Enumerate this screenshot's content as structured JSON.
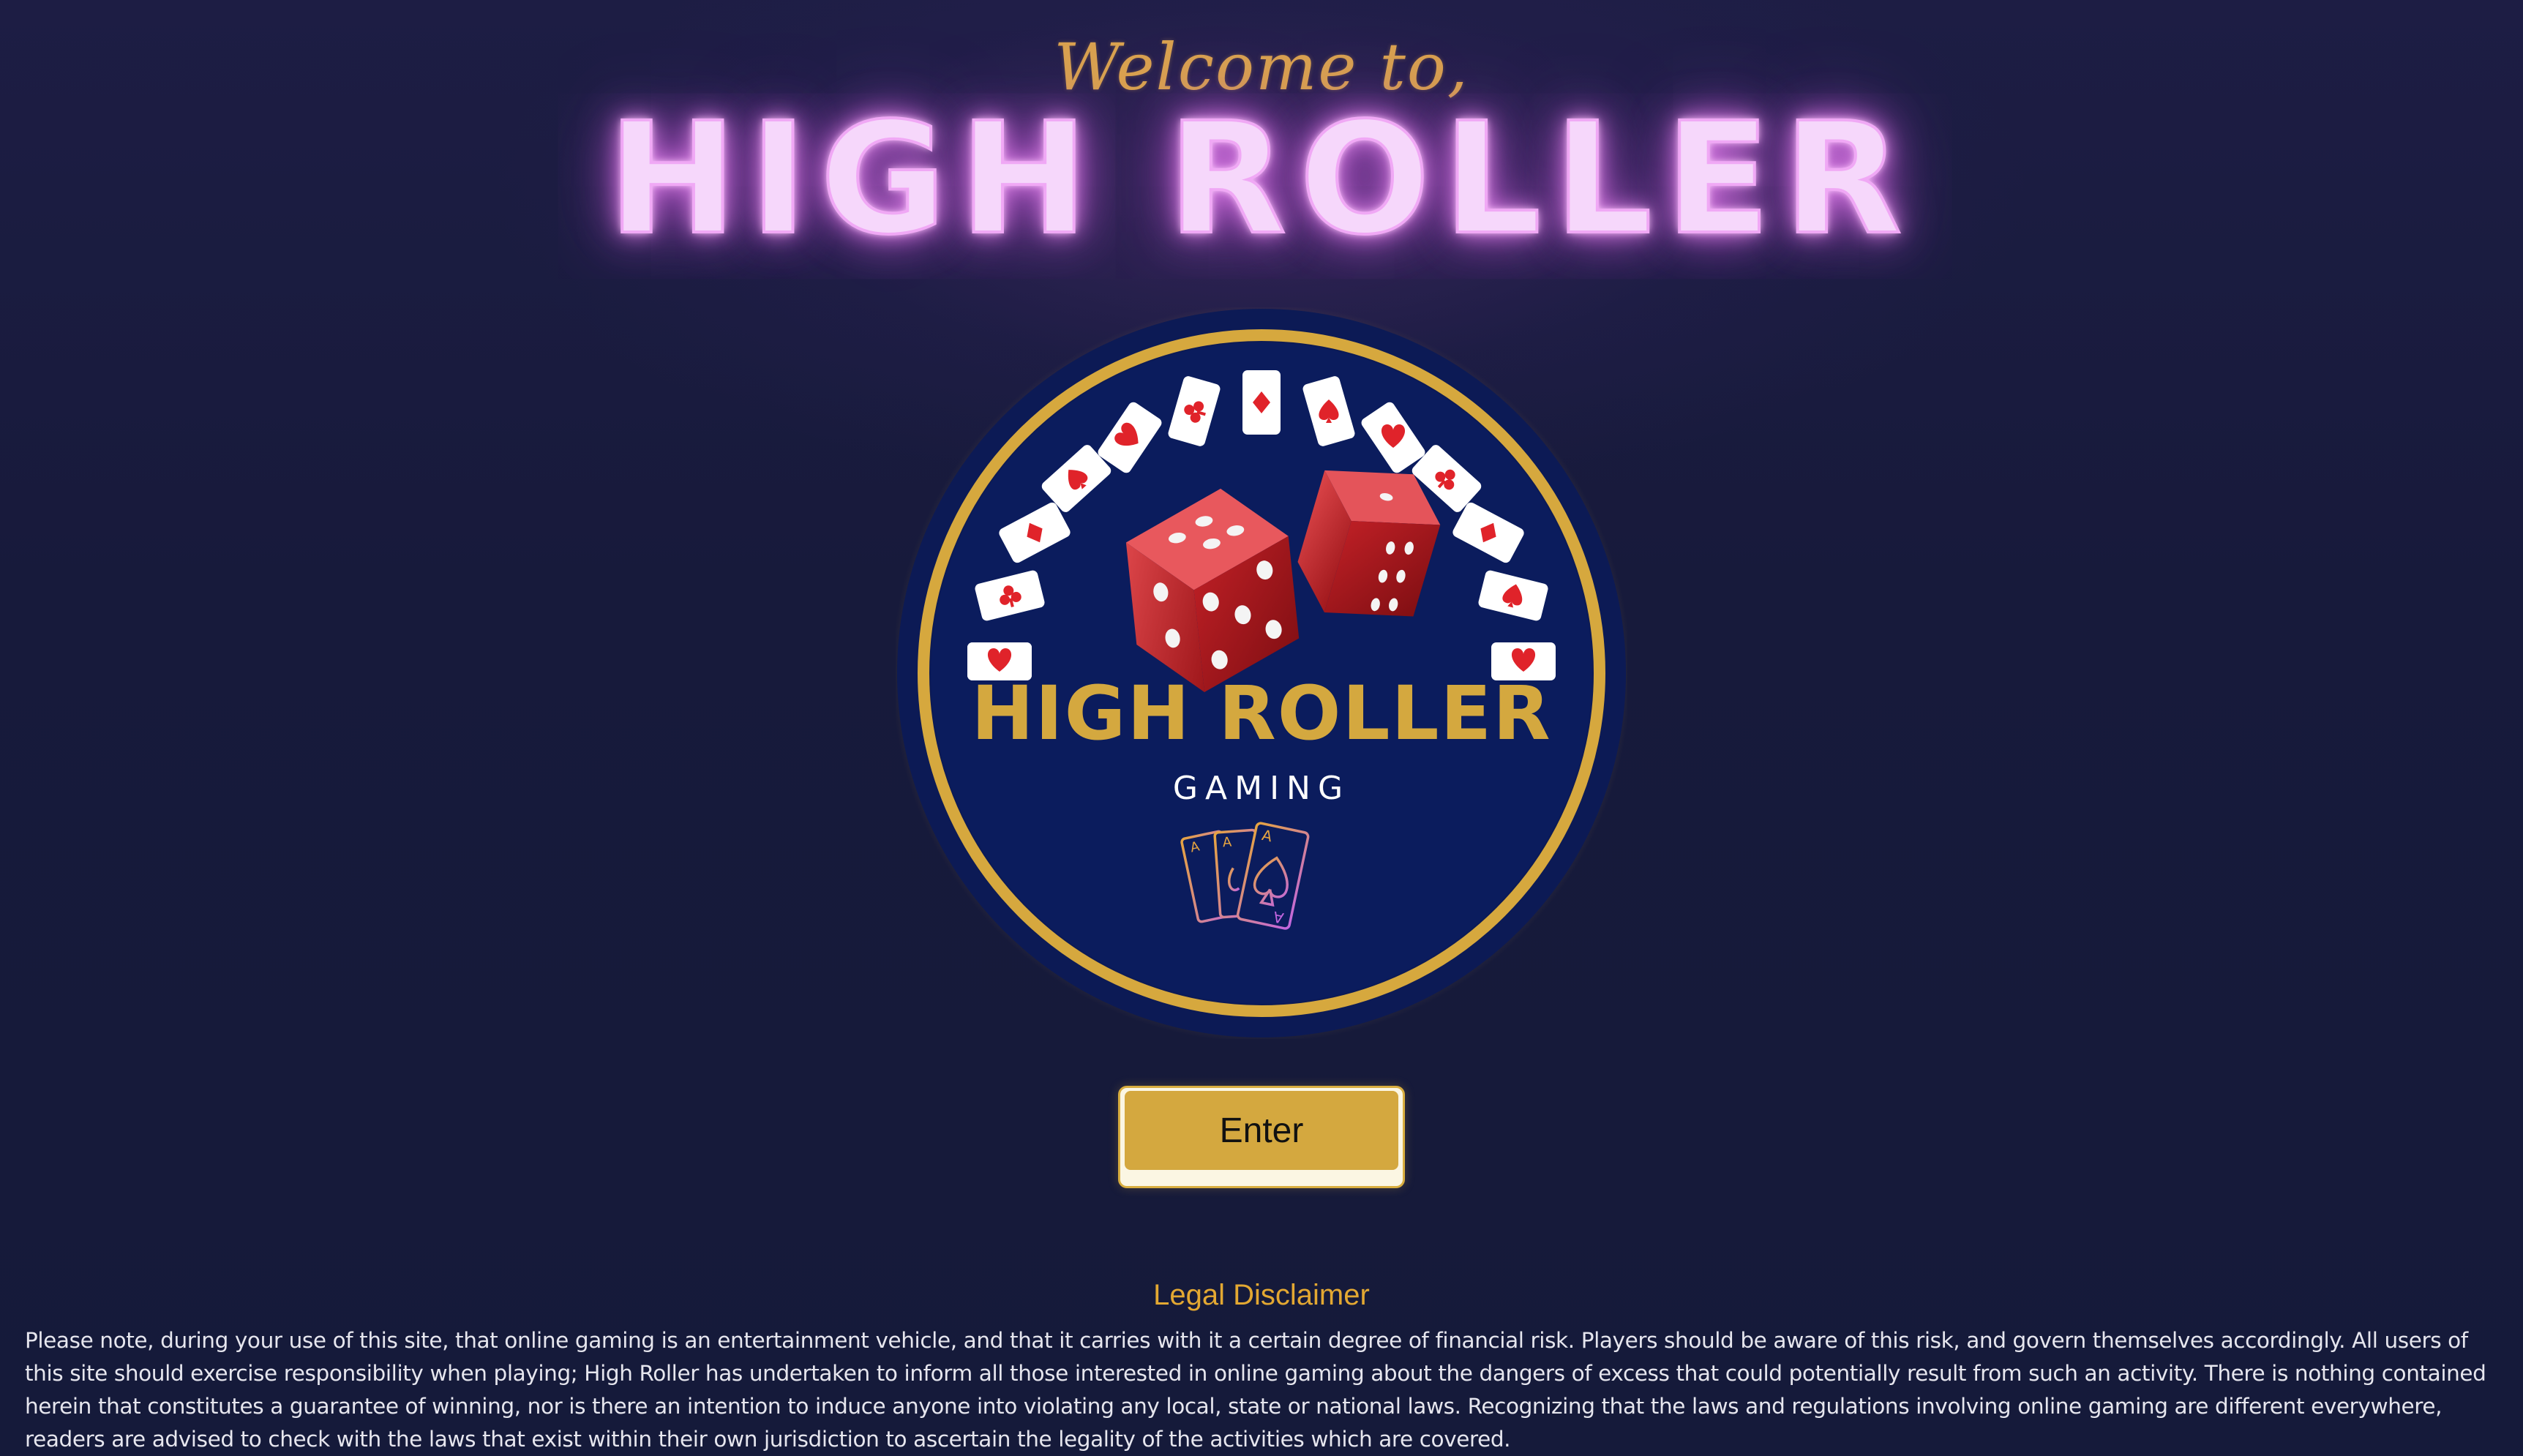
{
  "hero": {
    "welcome": "Welcome to,",
    "headline": "HIGH ROLLER"
  },
  "logo": {
    "brand": "HIGH ROLLER",
    "tagline": "GAMING",
    "card_letter": "A"
  },
  "actions": {
    "enter_label": "Enter"
  },
  "disclaimer": {
    "title": "Legal Disclaimer",
    "body": "Please note, during your use of this site, that online gaming is an entertainment vehicle, and that it carries with it a certain degree of financial risk. Players should be aware of this risk, and govern themselves accordingly. All users of this site should exercise responsibility when playing; High Roller has undertaken to inform all those interested in online gaming about the dangers of excess that could potentially result from such an activity. There is nothing contained herein that constitutes a guarantee of winning, nor is there an intention to induce anyone into violating any local, state or national laws. Recognizing that the laws and regulations involving online gaming are different everywhere, readers are advised to check with the laws that exist within their own jurisdiction to ascertain the legality of the activities which are covered."
  },
  "colors": {
    "background": "#16193a",
    "gold": "#d4a83f",
    "neon_pink": "#f0a8f5",
    "badge_navy": "#0d1d5e",
    "card_red": "#e0232a"
  }
}
